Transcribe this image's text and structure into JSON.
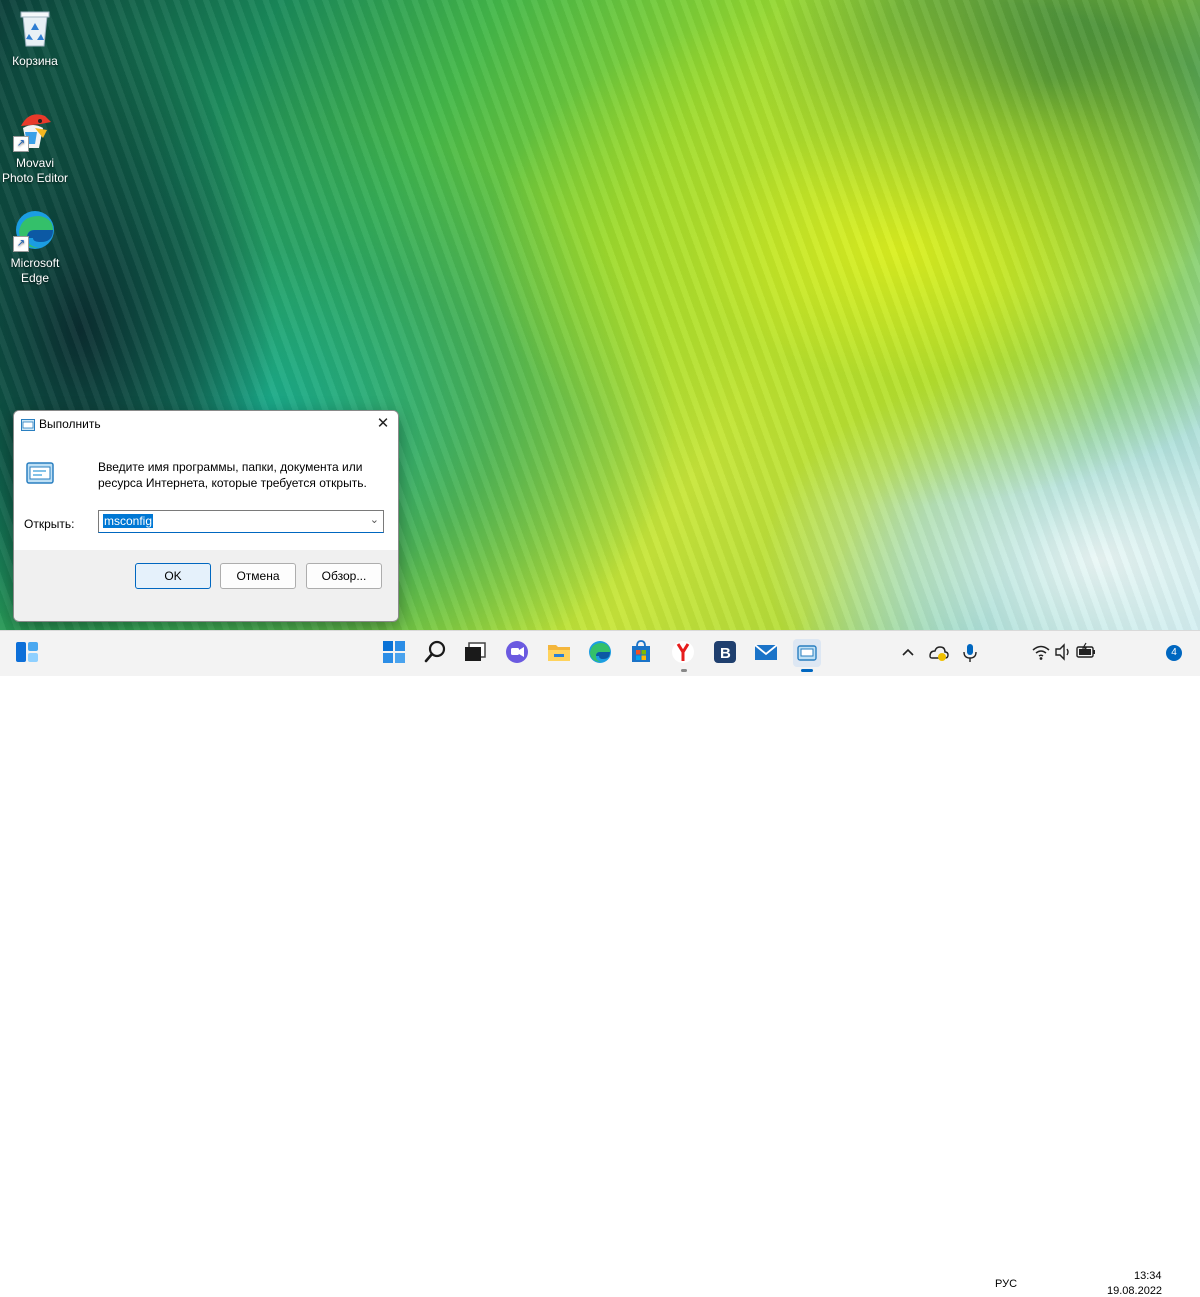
{
  "desktop": {
    "icons": [
      {
        "label": "Корзина",
        "icon": "recycle-bin-icon"
      },
      {
        "label": "Movavi Photo Editor",
        "icon": "movavi-icon"
      },
      {
        "label": "Microsoft Edge",
        "icon": "edge-icon"
      }
    ]
  },
  "run_dialog": {
    "title": "Выполнить",
    "description": "Введите имя программы, папки, документа или ресурса Интернета, которые требуется открыть.",
    "open_label": "Открыть:",
    "input_value": "msconfig",
    "buttons": {
      "ok": "OK",
      "cancel": "Отмена",
      "browse": "Обзор..."
    }
  },
  "taskbar": {
    "tray": {
      "language": "РУС",
      "time": "13:34",
      "date": "19.08.2022",
      "notification_count": "4"
    }
  },
  "colors": {
    "accent": "#0078d4",
    "taskbar_bg": "#f3f3f3"
  }
}
